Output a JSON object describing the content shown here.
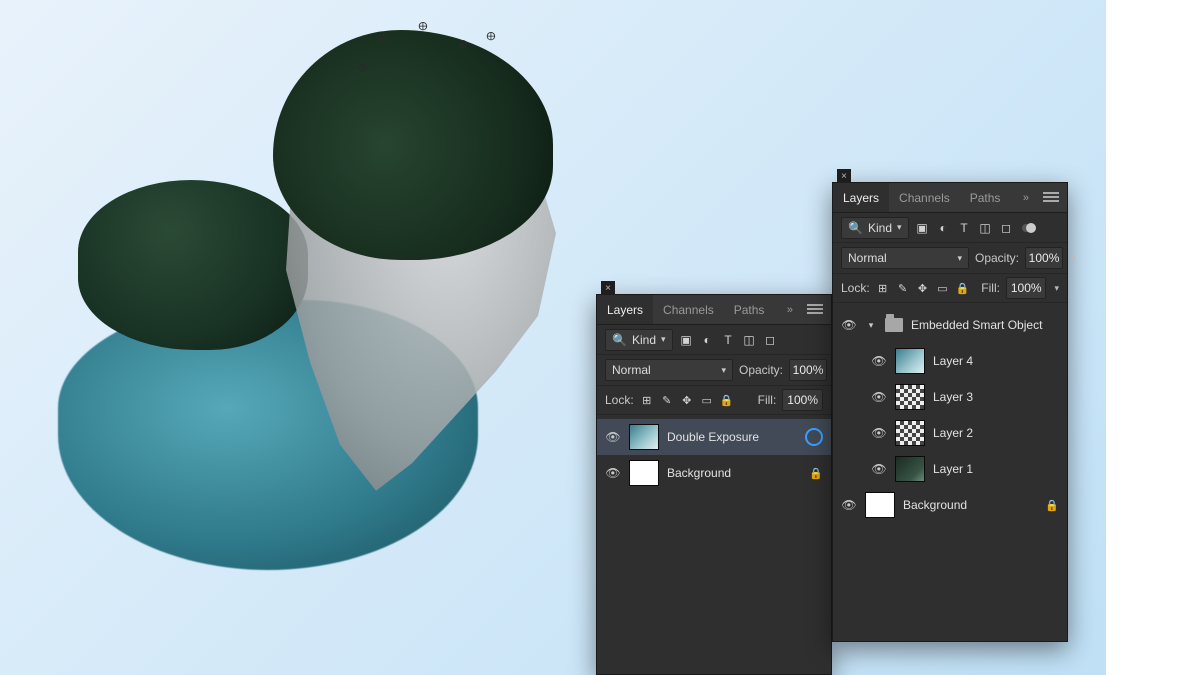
{
  "panelLeft": {
    "tabs": [
      "Layers",
      "Channels",
      "Paths"
    ],
    "activeTab": 0,
    "filter": "Kind",
    "blendMode": "Normal",
    "opacityLabel": "Opacity:",
    "opacityValue": "100%",
    "lockLabel": "Lock:",
    "fillLabel": "Fill:",
    "fillValue": "100%",
    "layers": [
      {
        "name": "Double Exposure",
        "visible": true,
        "selected": true,
        "thumb": "img",
        "progress": true
      },
      {
        "name": "Background",
        "visible": true,
        "thumb": "white",
        "locked": true
      }
    ]
  },
  "panelRight": {
    "tabs": [
      "Layers",
      "Channels",
      "Paths"
    ],
    "activeTab": 0,
    "filter": "Kind",
    "blendMode": "Normal",
    "opacityLabel": "Opacity:",
    "opacityValue": "100%",
    "lockLabel": "Lock:",
    "fillLabel": "Fill:",
    "fillValue": "100%",
    "groupName": "Embedded Smart Object",
    "layers": [
      {
        "name": "Layer 4",
        "visible": true,
        "thumb": "img"
      },
      {
        "name": "Layer 3",
        "visible": true,
        "thumb": "checker"
      },
      {
        "name": "Layer 2",
        "visible": true,
        "thumb": "checker"
      },
      {
        "name": "Layer 1",
        "visible": true,
        "thumb": "dark"
      }
    ],
    "background": {
      "name": "Background",
      "visible": true,
      "thumb": "white",
      "locked": true
    }
  },
  "icons": {
    "search": "🔍",
    "image": "▣",
    "adjust": "◐",
    "text": "T",
    "crop": "◫",
    "smart": "◻",
    "pixels": "⊞",
    "brush": "✎",
    "move": "✥",
    "frame": "▭",
    "lock": "🔒",
    "eye": "👁"
  }
}
